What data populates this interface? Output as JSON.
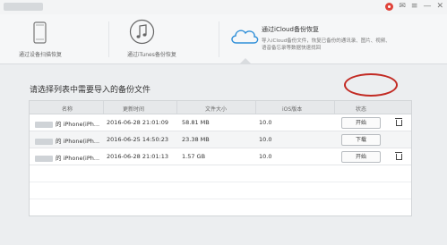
{
  "tabs": [
    {
      "label": "通过设备扫描恢复",
      "icon": "phone-icon"
    },
    {
      "label": "通过iTunes备份恢复",
      "icon": "music-note-icon"
    },
    {
      "label": "通过iCloud备份恢复",
      "icon": "cloud-icon",
      "desc_line1": "导入iCloud备份文件，恢复已备份的通讯录、图片、视频、",
      "desc_line2": "语音备忘录等数据快速找回"
    }
  ],
  "main": {
    "prompt": "请选择列表中需要导入的备份文件",
    "columns": [
      "名称",
      "更新时间",
      "文件大小",
      "iOS版本",
      "状态"
    ],
    "rows": [
      {
        "name": "的 iPhone(iPh...",
        "time": "2016-06-28 21:01:09",
        "size": "58.81 MB",
        "ios": "10.0",
        "action": "开始"
      },
      {
        "name": "的 iPhone(iPh...",
        "time": "2016-06-25 14:50:23",
        "size": "23.38 MB",
        "ios": "10.0",
        "action": "下载"
      },
      {
        "name": "的 iPhone(iPh...",
        "time": "2016-06-28 21:01:13",
        "size": "1.57 GB",
        "ios": "10.0",
        "action": "开始"
      }
    ]
  },
  "colors": {
    "highlight": "#c22a23",
    "cloud_blue": "#2f8fd8"
  }
}
